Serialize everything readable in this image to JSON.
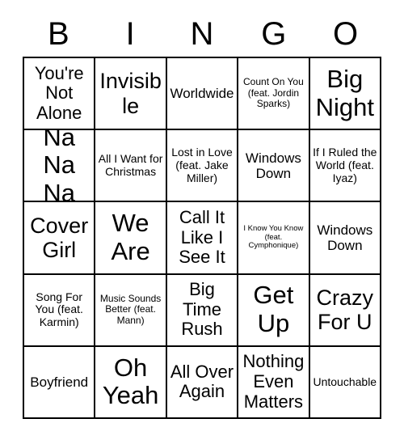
{
  "header": {
    "letters": [
      "B",
      "I",
      "N",
      "G",
      "O"
    ]
  },
  "grid": {
    "rows": [
      [
        {
          "label": "You're Not Alone",
          "size": "lg"
        },
        {
          "label": "Invisible",
          "size": "xl"
        },
        {
          "label": "Worldwide",
          "size": "md"
        },
        {
          "label": "Count On You (feat. Jordin Sparks)",
          "size": "xs"
        },
        {
          "label": "Big Night",
          "size": "xxl"
        }
      ],
      [
        {
          "label": "Na Na Na",
          "size": "xxl"
        },
        {
          "label": "All I Want for Christmas",
          "size": "sm"
        },
        {
          "label": "Lost in Love (feat. Jake Miller)",
          "size": "sm"
        },
        {
          "label": "Windows Down",
          "size": "md"
        },
        {
          "label": "If I Ruled the World (feat. Iyaz)",
          "size": "sm"
        }
      ],
      [
        {
          "label": "Cover Girl",
          "size": "xl"
        },
        {
          "label": "We Are",
          "size": "xxl"
        },
        {
          "label": "Call It Like I See It",
          "size": "lg"
        },
        {
          "label": "I Know You Know (feat. Cymphonique)",
          "size": "xxs"
        },
        {
          "label": "Windows Down",
          "size": "md"
        }
      ],
      [
        {
          "label": "Song For You (feat. Karmin)",
          "size": "sm"
        },
        {
          "label": "Music Sounds Better (feat. Mann)",
          "size": "xs"
        },
        {
          "label": "Big Time Rush",
          "size": "lg"
        },
        {
          "label": "Get Up",
          "size": "xxl"
        },
        {
          "label": "Crazy For U",
          "size": "xl"
        }
      ],
      [
        {
          "label": "Boyfriend",
          "size": "md"
        },
        {
          "label": "Oh Yeah",
          "size": "xxl"
        },
        {
          "label": "All Over Again",
          "size": "lg"
        },
        {
          "label": "Nothing Even Matters",
          "size": "lg"
        },
        {
          "label": "Untouchable",
          "size": "sm"
        }
      ]
    ]
  }
}
